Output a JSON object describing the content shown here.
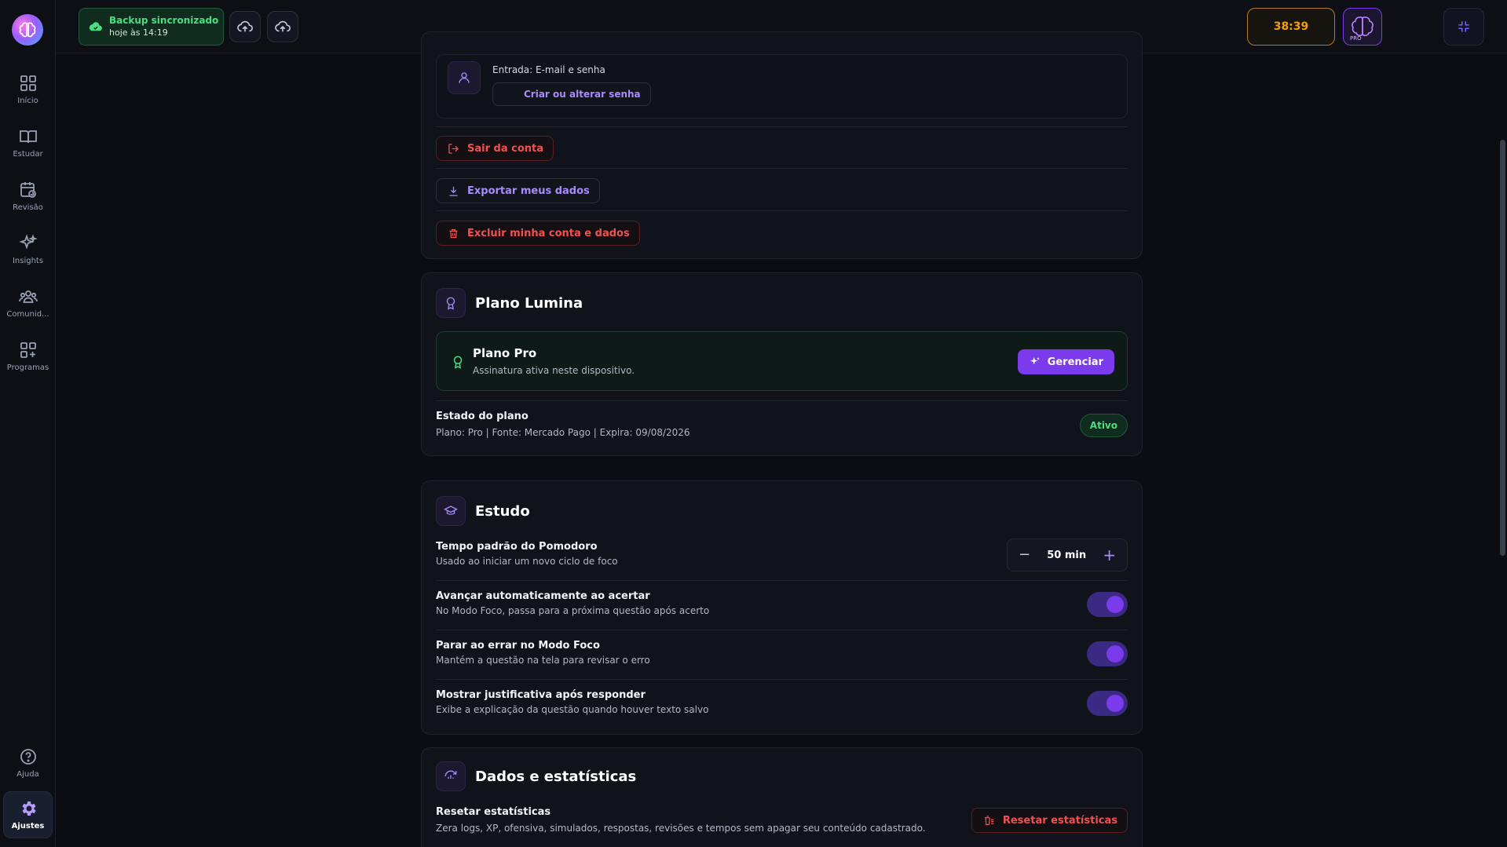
{
  "topbar": {
    "backup_title": "Backup sincronizado",
    "backup_time": "hoje às 14:19",
    "timer": "38:39",
    "pro_badge": "PRO"
  },
  "sidebar": {
    "items": [
      {
        "label": "Início",
        "icon": "grid-icon"
      },
      {
        "label": "Estudar",
        "icon": "book-open-icon"
      },
      {
        "label": "Revisão",
        "icon": "calendar-refresh-icon"
      },
      {
        "label": "Insights",
        "icon": "sparkles-icon"
      },
      {
        "label": "Comunid...",
        "icon": "users-icon"
      },
      {
        "label": "Programas",
        "icon": "grid-plus-icon"
      }
    ],
    "help_label": "Ajuda",
    "settings_label": "Ajustes"
  },
  "account": {
    "login_text": "Entrada: E-mail e senha",
    "password_button": "Criar ou alterar senha",
    "logout_button": "Sair da conta",
    "export_button": "Exportar meus dados",
    "delete_button": "Excluir minha conta e dados"
  },
  "plan": {
    "section_title": "Plano Lumina",
    "plan_name": "Plano Pro",
    "plan_desc": "Assinatura ativa neste dispositivo.",
    "manage_button": "Gerenciar",
    "state_title": "Estado do plano",
    "state_detail": "Plano: Pro | Fonte: Mercado Pago | Expira: 09/08/2026",
    "state_badge": "Ativo"
  },
  "study": {
    "section_title": "Estudo",
    "pomodoro_title": "Tempo padrão do Pomodoro",
    "pomodoro_desc": "Usado ao iniciar um novo ciclo de foco",
    "pomodoro_value": "50 min",
    "auto_advance_title": "Avançar automaticamente ao acertar",
    "auto_advance_desc": "No Modo Foco, passa para a próxima questão após acerto",
    "auto_advance_on": true,
    "stop_error_title": "Parar ao errar no Modo Foco",
    "stop_error_desc": "Mantém a questão na tela para revisar o erro",
    "stop_error_on": true,
    "show_just_title": "Mostrar justificativa após responder",
    "show_just_desc": "Exibe a explicação da questão quando houver texto salvo",
    "show_just_on": true
  },
  "data_stats": {
    "section_title": "Dados e estatísticas",
    "reset_title": "Resetar estatísticas",
    "reset_desc": "Zera logs, XP, ofensiva, simulados, respostas, revisões e tempos sem apagar seu conteúdo cadastrado.",
    "reset_button": "Resetar estatísticas"
  },
  "colors": {
    "accent": "#7c3aed",
    "success": "#4ade80",
    "danger": "#f05252",
    "timer": "#f59e0b"
  }
}
